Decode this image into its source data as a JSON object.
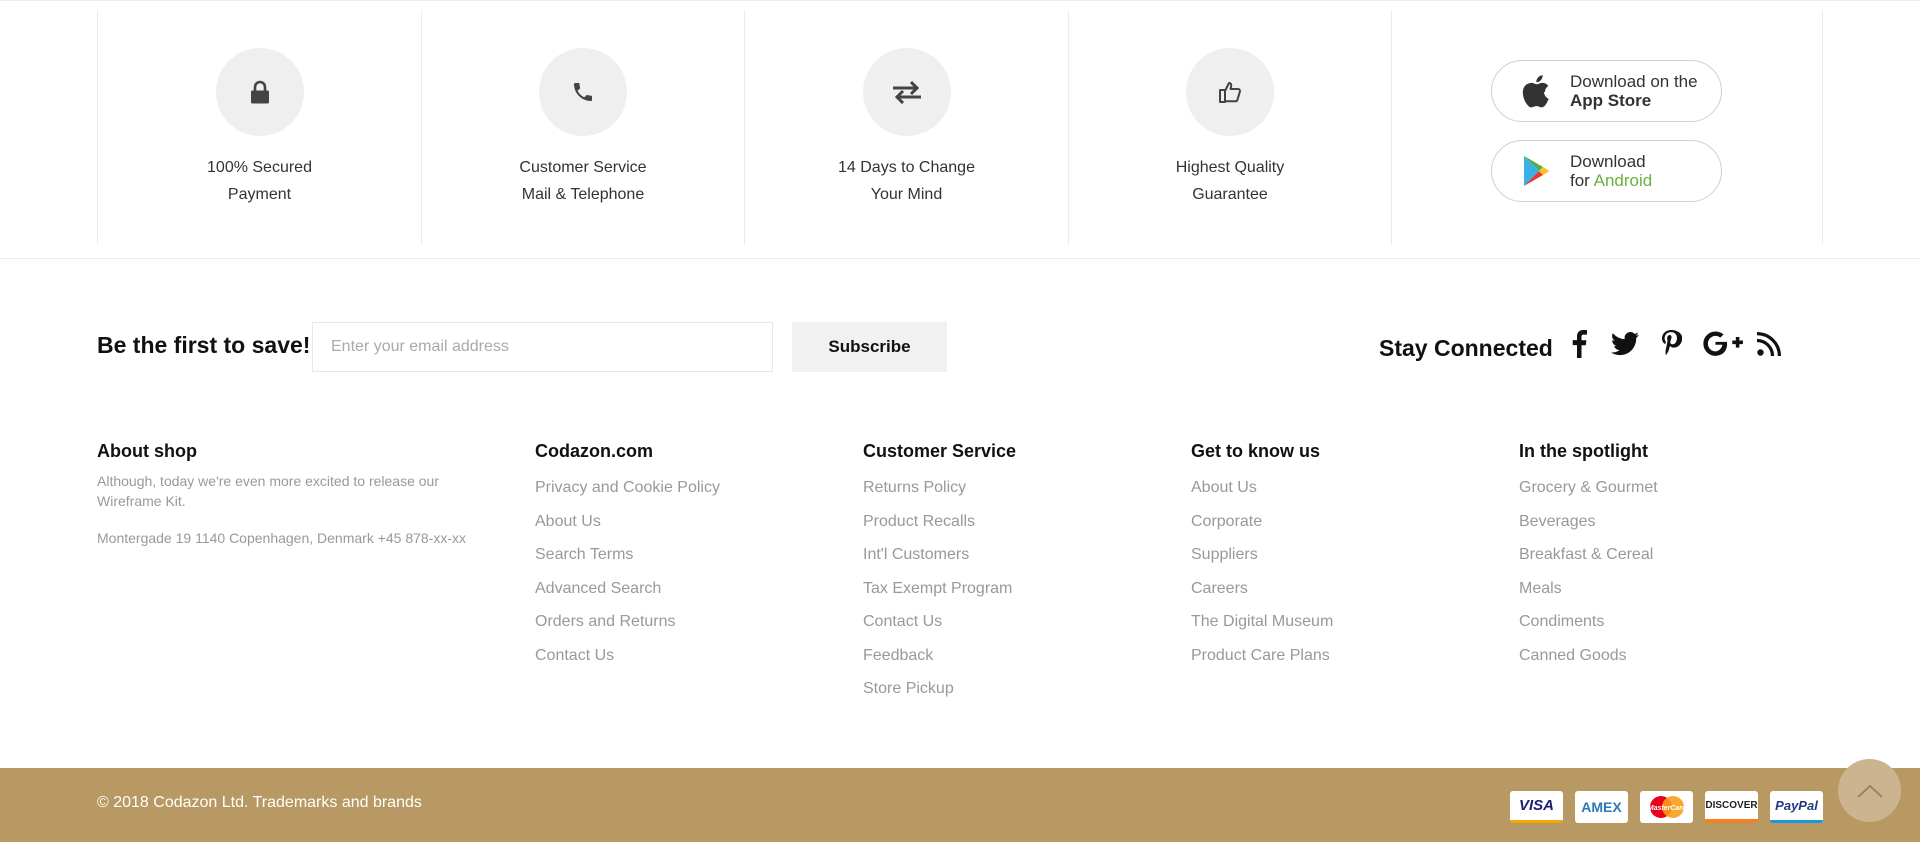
{
  "features": [
    {
      "icon": "lock-icon",
      "line1": "100% Secured",
      "line2": "Payment"
    },
    {
      "icon": "phone-icon",
      "line1": "Customer Service",
      "line2": "Mail & Telephone"
    },
    {
      "icon": "exchange-arrows-icon",
      "line1": "14 Days to Change",
      "line2": "Your Mind"
    },
    {
      "icon": "thumbs-up-icon",
      "line1": "Highest Quality",
      "line2": "Guarantee"
    }
  ],
  "app_store": {
    "line1": "Download on the",
    "line2": "App Store"
  },
  "google_play": {
    "line1": "Download",
    "line2_prefix": "for ",
    "line2_highlight": "Android"
  },
  "newsletter": {
    "title": "Be the first to save!",
    "placeholder": "Enter your email address",
    "button": "Subscribe"
  },
  "social": {
    "title": "Stay Connected",
    "icons": [
      "facebook-icon",
      "twitter-icon",
      "pinterest-icon",
      "google-plus-icon",
      "rss-icon"
    ]
  },
  "about": {
    "title": "About shop",
    "text": "Although, today we're even more excited to release our Wireframe Kit.",
    "address": "Montergade 19 1140 Copenhagen, Denmark +45 878-xx-xx"
  },
  "columns": [
    {
      "title": "Codazon.com",
      "links": [
        "Privacy and Cookie Policy",
        "About Us",
        "Search Terms",
        "Advanced Search",
        "Orders and Returns",
        "Contact Us"
      ]
    },
    {
      "title": "Customer Service",
      "links": [
        "Returns Policy",
        "Product Recalls",
        "Int'l Customers",
        "Tax Exempt Program",
        "Contact Us",
        "Feedback",
        "Store Pickup"
      ]
    },
    {
      "title": "Get to know us",
      "links": [
        "About Us",
        "Corporate",
        "Suppliers",
        "Careers",
        "The Digital Museum",
        "Product Care Plans"
      ]
    },
    {
      "title": "In the spotlight",
      "links": [
        "Grocery & Gourmet",
        "Beverages",
        "Breakfast & Cereal",
        "Meals",
        "Condiments",
        "Canned Goods"
      ]
    }
  ],
  "copyright": "© 2018 Codazon Ltd. Trademarks and brands",
  "payments": [
    "VISA",
    "AMEX",
    "MasterCard",
    "DISCOVER",
    "PayPal"
  ],
  "colors": {
    "footer_bar": "#b89963",
    "back_to_top": "#cbb48e",
    "android_green": "#6bb13c"
  }
}
